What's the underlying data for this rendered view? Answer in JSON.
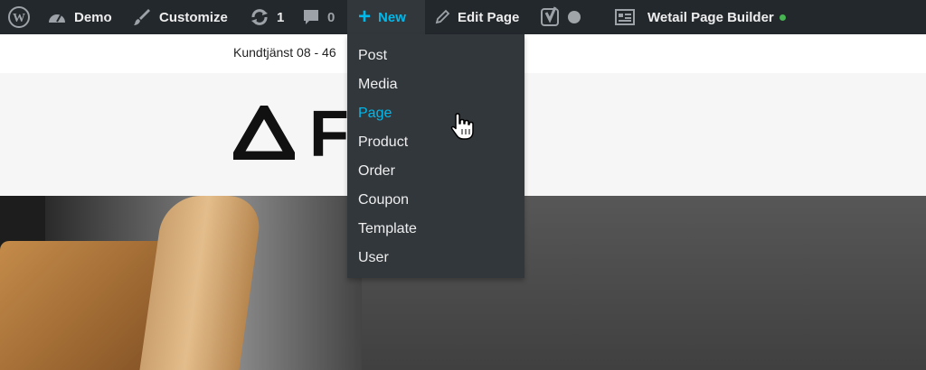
{
  "adminbar": {
    "site_name": "Demo",
    "customize": "Customize",
    "updates_count": "1",
    "comments_count": "0",
    "new_label": "New",
    "edit_page": "Edit Page",
    "page_builder": "Wetail Page Builder"
  },
  "new_menu": {
    "items": [
      "Post",
      "Media",
      "Page",
      "Product",
      "Order",
      "Coupon",
      "Template",
      "User"
    ],
    "active_item": "Page"
  },
  "site": {
    "service_text": "Kundtjänst 08 - 46",
    "logo_text": "FA G"
  },
  "colors": {
    "adminbar_bg": "#23282d",
    "submenu_bg": "#32373c",
    "accent": "#00b9eb",
    "status_green": "#46b450"
  },
  "icons": [
    "wordpress-icon",
    "dashboard-icon",
    "brush-icon",
    "update-icon",
    "comment-icon",
    "plus-icon",
    "pencil-icon",
    "yoast-icon",
    "builder-icon",
    "hand-cursor-icon"
  ]
}
